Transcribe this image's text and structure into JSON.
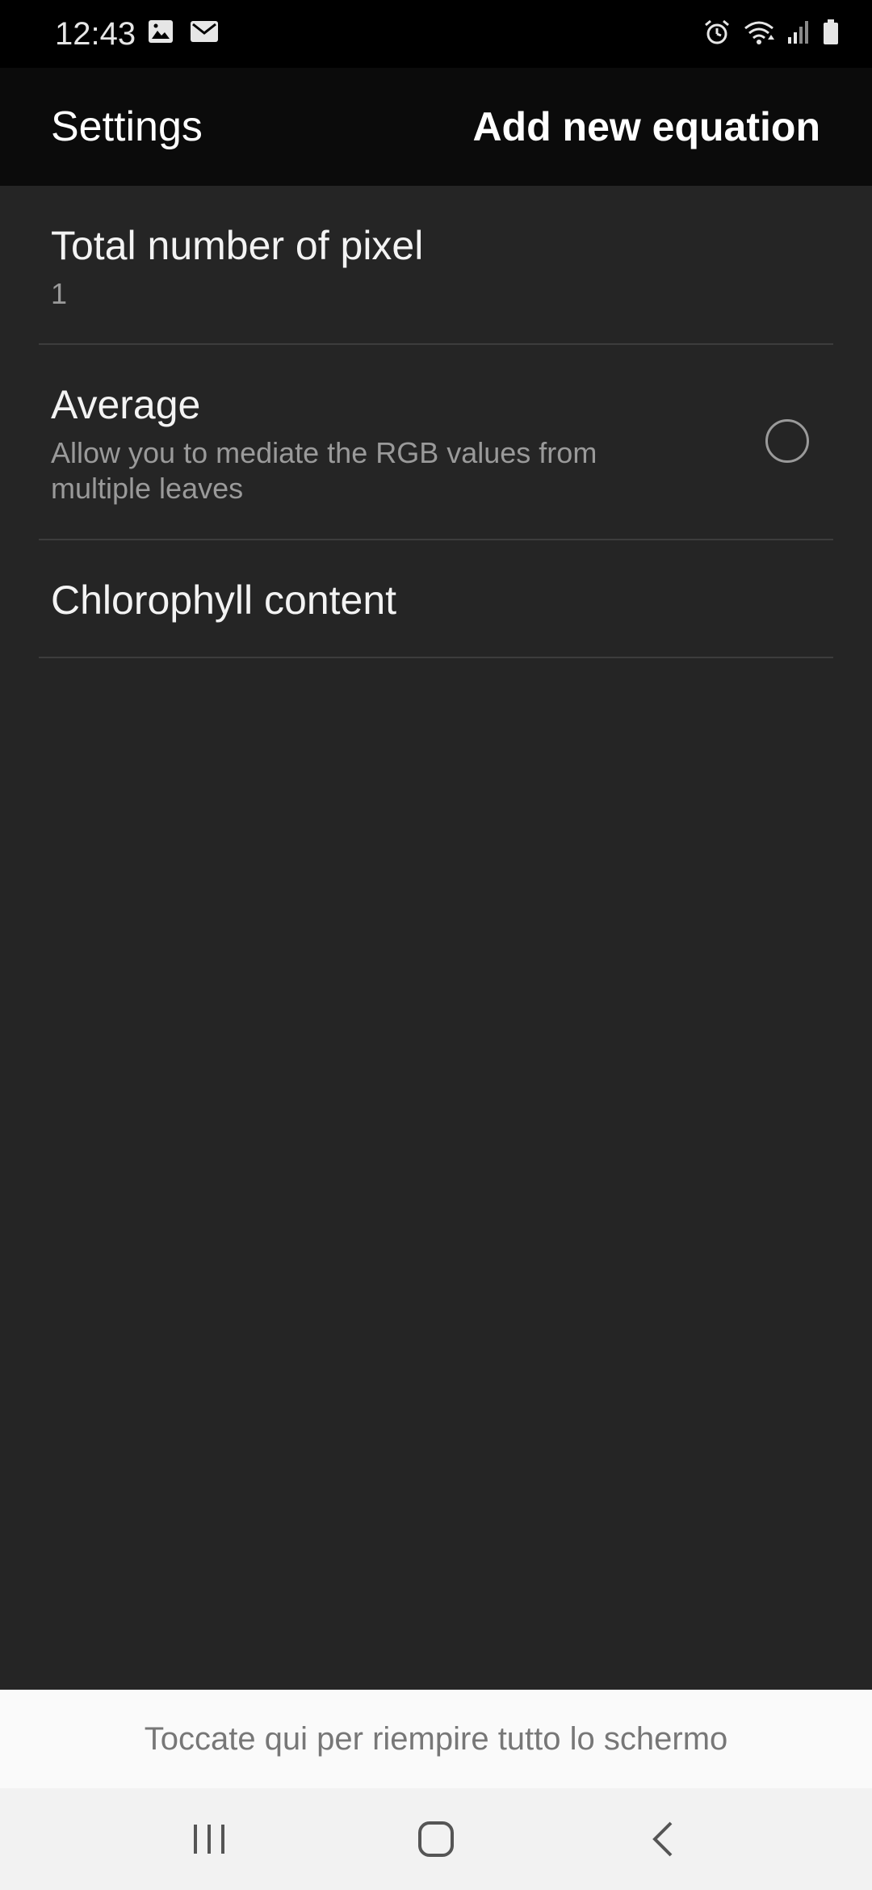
{
  "status_bar": {
    "time": "12:43",
    "left_icons": [
      "gallery-icon",
      "email-icon"
    ],
    "right_icons": [
      "alarm-icon",
      "wifi-icon",
      "signal-icon",
      "battery-icon"
    ]
  },
  "app_bar": {
    "title": "Settings",
    "action_label": "Add new equation"
  },
  "preferences": [
    {
      "title": "Total number of pixel",
      "summary": "1"
    },
    {
      "title": "Average",
      "summary": "Allow you to mediate the RGB values from multiple leaves",
      "checked": false
    },
    {
      "title": "Chlorophyll content"
    }
  ],
  "ad_banner": {
    "text": "Toccate qui per riempire tutto lo schermo"
  },
  "nav_bar": {
    "buttons": [
      "recents-icon",
      "home-icon",
      "back-icon"
    ]
  },
  "colors": {
    "background": "#252525",
    "app_bar": "#0b0b0b",
    "status_bar": "#000000",
    "divider": "#3d3d3d"
  }
}
